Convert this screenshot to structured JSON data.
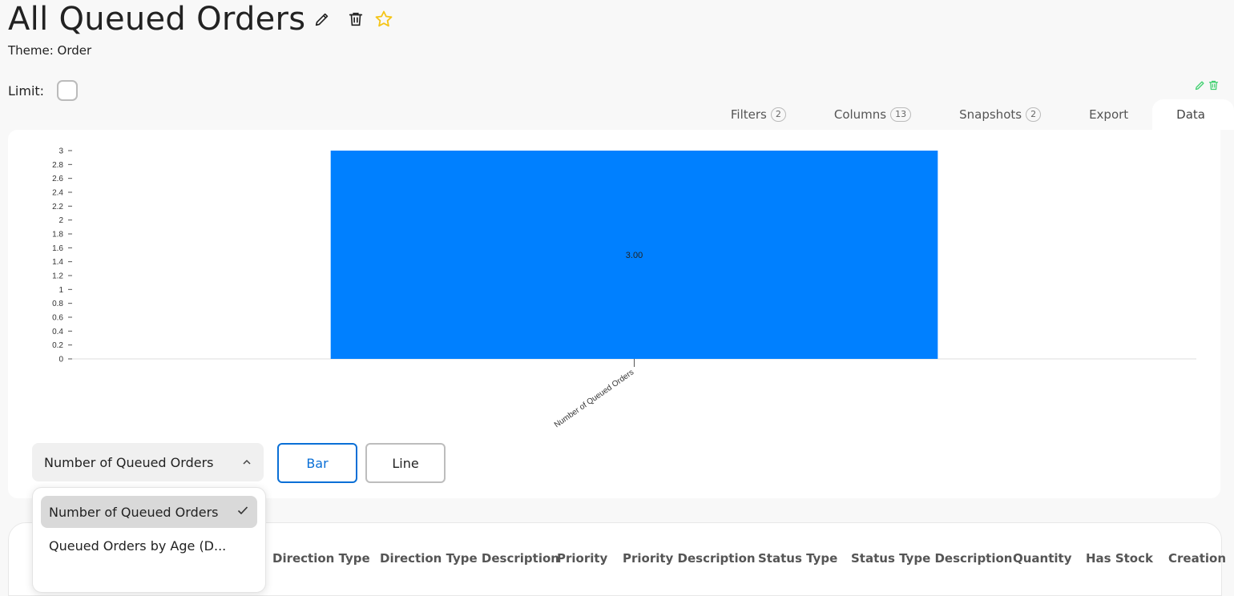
{
  "header": {
    "title": "All Queued Orders",
    "theme": "Theme: Order",
    "limit_label": "Limit:"
  },
  "tabs": [
    {
      "label": "Filters",
      "count": "2"
    },
    {
      "label": "Columns",
      "count": "13"
    },
    {
      "label": "Snapshots",
      "count": "2"
    },
    {
      "label": "Export",
      "count": ""
    },
    {
      "label": "Data",
      "count": "",
      "active": true
    }
  ],
  "colors": {
    "bar": "#0080ff",
    "accent": "#0a6fd6",
    "star": "#f5c518",
    "corner_icons": "#3ecf6e"
  },
  "chart_data": {
    "type": "bar",
    "categories": [
      "Number of Queued Orders"
    ],
    "values": [
      3
    ],
    "data_labels": [
      "3.00"
    ],
    "ylim": [
      0,
      3
    ],
    "yticks": [
      "0",
      "0.2",
      "0.4",
      "0.6",
      "0.8",
      "1",
      "1.2",
      "1.4",
      "1.6",
      "1.8",
      "2",
      "2.2",
      "2.4",
      "2.6",
      "2.8",
      "3"
    ],
    "xlabel": "",
    "ylabel": "",
    "grid": false
  },
  "controls": {
    "series_select": "Number of Queued Orders",
    "bar_label": "Bar",
    "line_label": "Line"
  },
  "dropdown": {
    "options": [
      {
        "label": "Number of Queued Orders",
        "selected": true
      },
      {
        "label": "Queued Orders by Age (D...",
        "selected": false
      }
    ]
  },
  "table": {
    "columns": [
      "Direction Type",
      "Direction Type Description",
      "Priority",
      "Priority Description",
      "Status Type",
      "Status Type Description",
      "Quantity",
      "Has Stock",
      "Creation"
    ]
  }
}
